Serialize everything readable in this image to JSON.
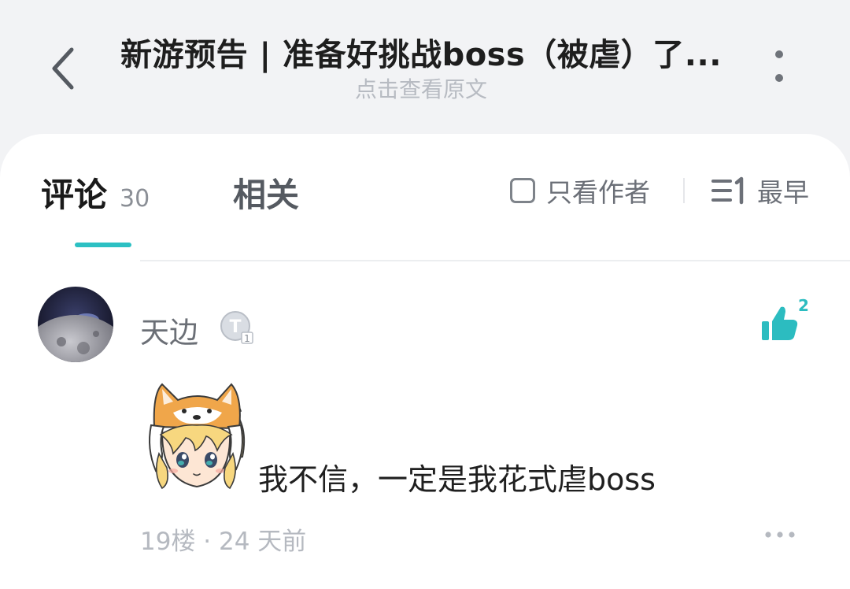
{
  "header": {
    "title": "新游预告 | 准备好挑战boss（被虐）了...",
    "subtitle": "点击查看原文",
    "back_icon": "chevron-left-icon",
    "more_icon": "more-vertical-icon"
  },
  "tabs": {
    "comments_label": "评论",
    "comments_count": "30",
    "related_label": "相关",
    "accent_color": "#2cc0c3"
  },
  "filters": {
    "author_only_label": "只看作者",
    "sort_label": "最早",
    "sort_icon": "sort-list-icon"
  },
  "comment": {
    "username": "天边",
    "badge_icon": "level-badge-icon",
    "like_count": "2",
    "like_icon": "thumbs-up-icon",
    "sticker_icon": "shiba-girl-sticker",
    "text": "我不信，一定是我花式虐boss",
    "meta": "19楼 · 24 天前",
    "more_icon": "more-horizontal-icon"
  }
}
